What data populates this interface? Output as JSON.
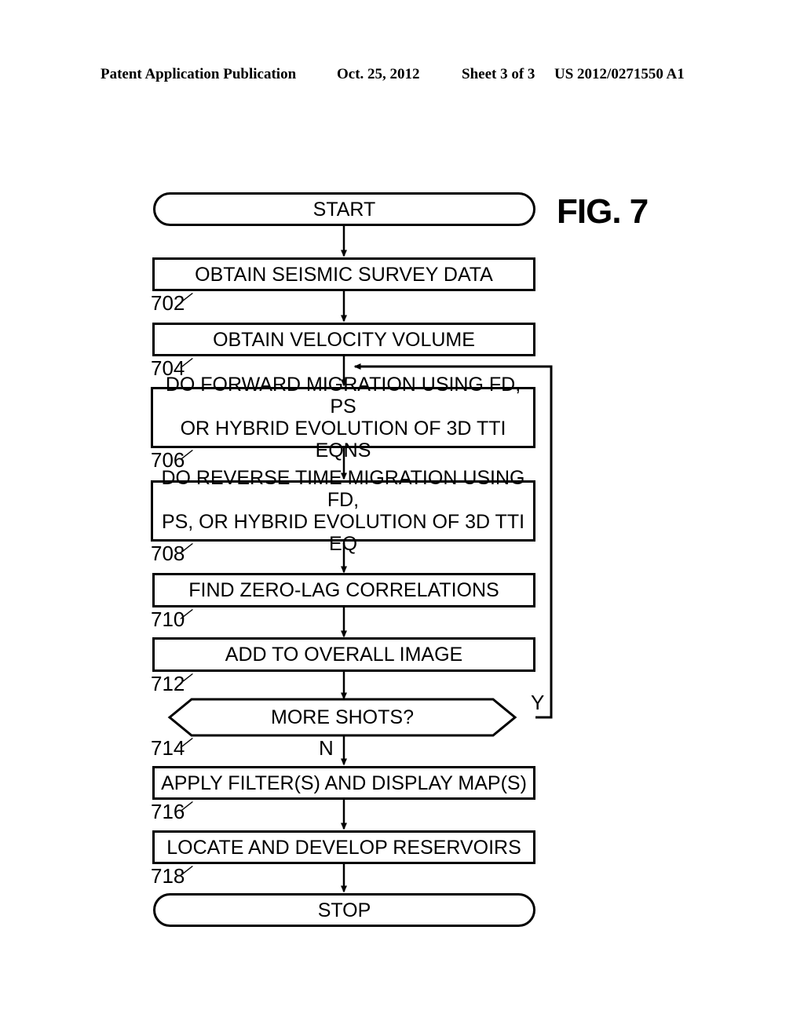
{
  "header": {
    "publication": "Patent Application Publication",
    "date": "Oct. 25, 2012",
    "sheet": "Sheet 3 of 3",
    "publication_number": "US 2012/0271550 A1"
  },
  "figure": {
    "label": "FIG. 7"
  },
  "flowchart": {
    "type": "flowchart",
    "start": {
      "label": "START",
      "shape": "terminal"
    },
    "end": {
      "label": "STOP",
      "shape": "terminal"
    },
    "nodes": [
      {
        "ref": "702",
        "label": "OBTAIN SEISMIC SURVEY DATA",
        "shape": "process"
      },
      {
        "ref": "704",
        "label": "OBTAIN VELOCITY VOLUME",
        "shape": "process"
      },
      {
        "ref": "706",
        "label": "DO FORWARD MIGRATION USING FD, PS\nOR HYBRID EVOLUTION OF 3D TTI EQNS",
        "shape": "process"
      },
      {
        "ref": "708",
        "label": "DO REVERSE TIME MIGRATION USING FD,\nPS, OR HYBRID EVOLUTION OF 3D TTI EQ",
        "shape": "process"
      },
      {
        "ref": "710",
        "label": "FIND ZERO-LAG CORRELATIONS",
        "shape": "process"
      },
      {
        "ref": "712",
        "label": "ADD TO OVERALL IMAGE",
        "shape": "process"
      },
      {
        "ref": "714",
        "label": "MORE SHOTS?",
        "shape": "decision"
      },
      {
        "ref": "716",
        "label": "APPLY FILTER(S) AND DISPLAY MAP(S)",
        "shape": "process"
      },
      {
        "ref": "718",
        "label": "LOCATE AND DEVELOP RESERVOIRS",
        "shape": "process"
      }
    ],
    "branches": {
      "yes": "Y",
      "no": "N"
    },
    "refnum_tick": "⁄"
  },
  "colors": {
    "ink": "#000000",
    "paper": "#ffffff"
  }
}
